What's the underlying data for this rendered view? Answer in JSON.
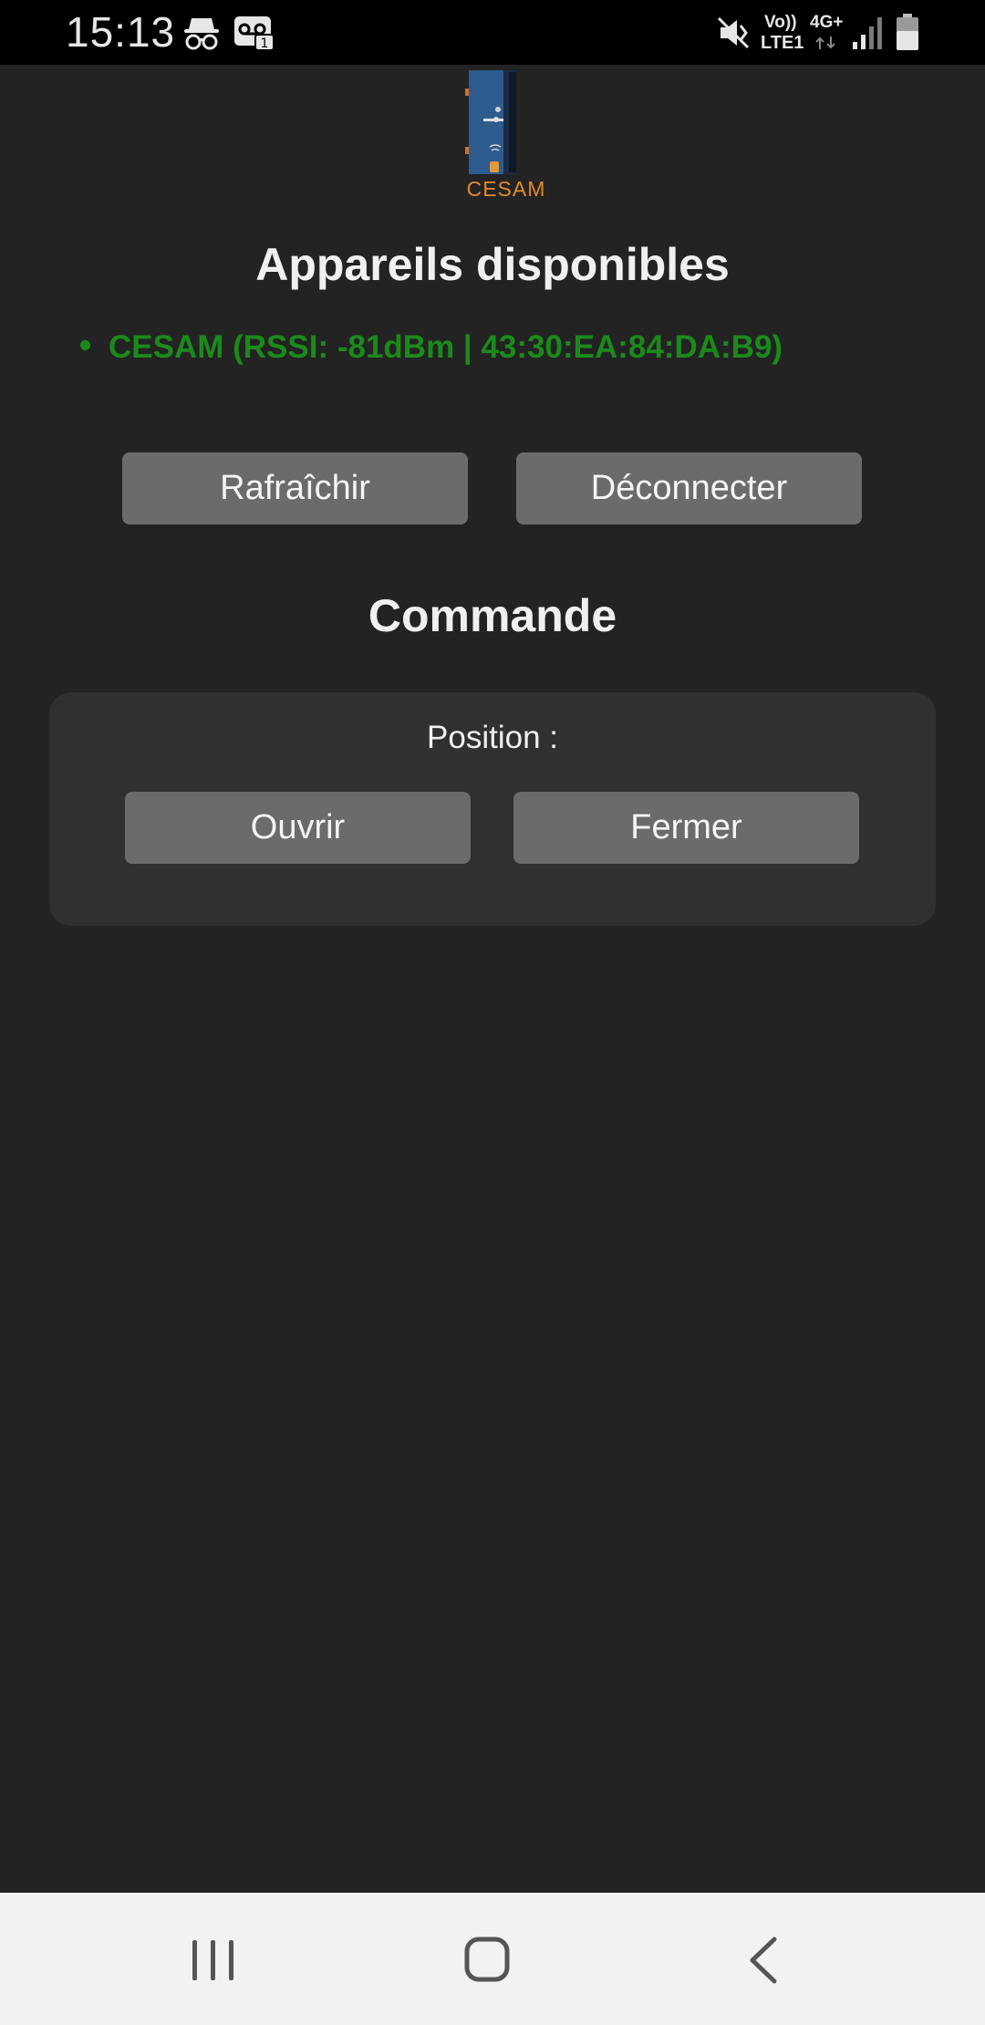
{
  "status_bar": {
    "time": "15:13",
    "volte_label": "Vo))",
    "lte_label": "LTE1",
    "network_label": "4G+"
  },
  "app": {
    "logo_label": "CESAM",
    "devices_title": "Appareils disponibles",
    "devices": [
      {
        "label": "CESAM (RSSI: -81dBm | 43:30:EA:84:DA:B9)"
      }
    ],
    "buttons": {
      "refresh": "Rafraîchir",
      "disconnect": "Déconnecter"
    },
    "command": {
      "title": "Commande",
      "position_label": "Position :",
      "open": "Ouvrir",
      "close": "Fermer"
    }
  },
  "colors": {
    "background": "#232323",
    "panel": "#303030",
    "button": "#6b6b6b",
    "device_text": "#1b8a1b",
    "logo_text": "#e08a2e"
  },
  "nav_bar": {
    "icons": [
      "recents-icon",
      "home-icon",
      "back-icon"
    ]
  }
}
